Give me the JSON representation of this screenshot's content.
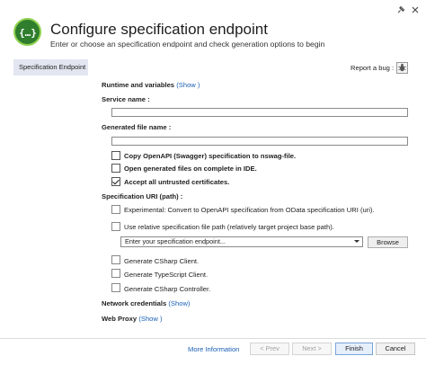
{
  "header": {
    "title": "Configure specification endpoint",
    "subtitle": "Enter or choose an specification endpoint and check generation options to begin"
  },
  "nav": {
    "items": [
      {
        "label": "Specification Endpoint",
        "selected": true
      }
    ]
  },
  "report": {
    "label": "Report a bug :"
  },
  "runtime": {
    "label": "Runtime and variables",
    "link": "(Show )"
  },
  "service_name": {
    "label": "Service name :",
    "value": ""
  },
  "generated_file": {
    "label": "Generated file name :",
    "value": ""
  },
  "options": [
    {
      "label": "Copy OpenAPI (Swagger) specification to nswag-file.",
      "checked": false
    },
    {
      "label": "Open generated files on complete in IDE.",
      "checked": false
    },
    {
      "label": "Accept all untrusted certificates.",
      "checked": true
    }
  ],
  "spec_uri": {
    "label": "Specification URI (path) :",
    "experimental": "Experimental: Convert to OpenAPI specification from OData specification URI (uri).",
    "relative": "Use relative specification file path (relatively target project base path).",
    "endpoint_placeholder": "Enter your specification endpoint...",
    "browse": "Browse"
  },
  "generate": [
    {
      "label": "Generate CSharp Client.",
      "checked": false
    },
    {
      "label": "Generate TypeScript Client.",
      "checked": false
    },
    {
      "label": "Generate CSharp Controller.",
      "checked": false
    }
  ],
  "network": {
    "label": "Network credentials",
    "link": "(Show)"
  },
  "proxy": {
    "label": "Web Proxy",
    "link": "(Show )"
  },
  "footer": {
    "more_info": "More Information",
    "prev": "< Prev",
    "next": "Next >",
    "finish": "Finish",
    "cancel": "Cancel"
  },
  "colors": {
    "accent": "#1a5fb4",
    "logo": "#2f7d2d",
    "nav_selected": "#e2e6f0"
  },
  "icons": {
    "logo": "swagger-logo-icon",
    "pin": "pin-icon",
    "close": "close-icon",
    "bug": "bug-report-icon"
  }
}
